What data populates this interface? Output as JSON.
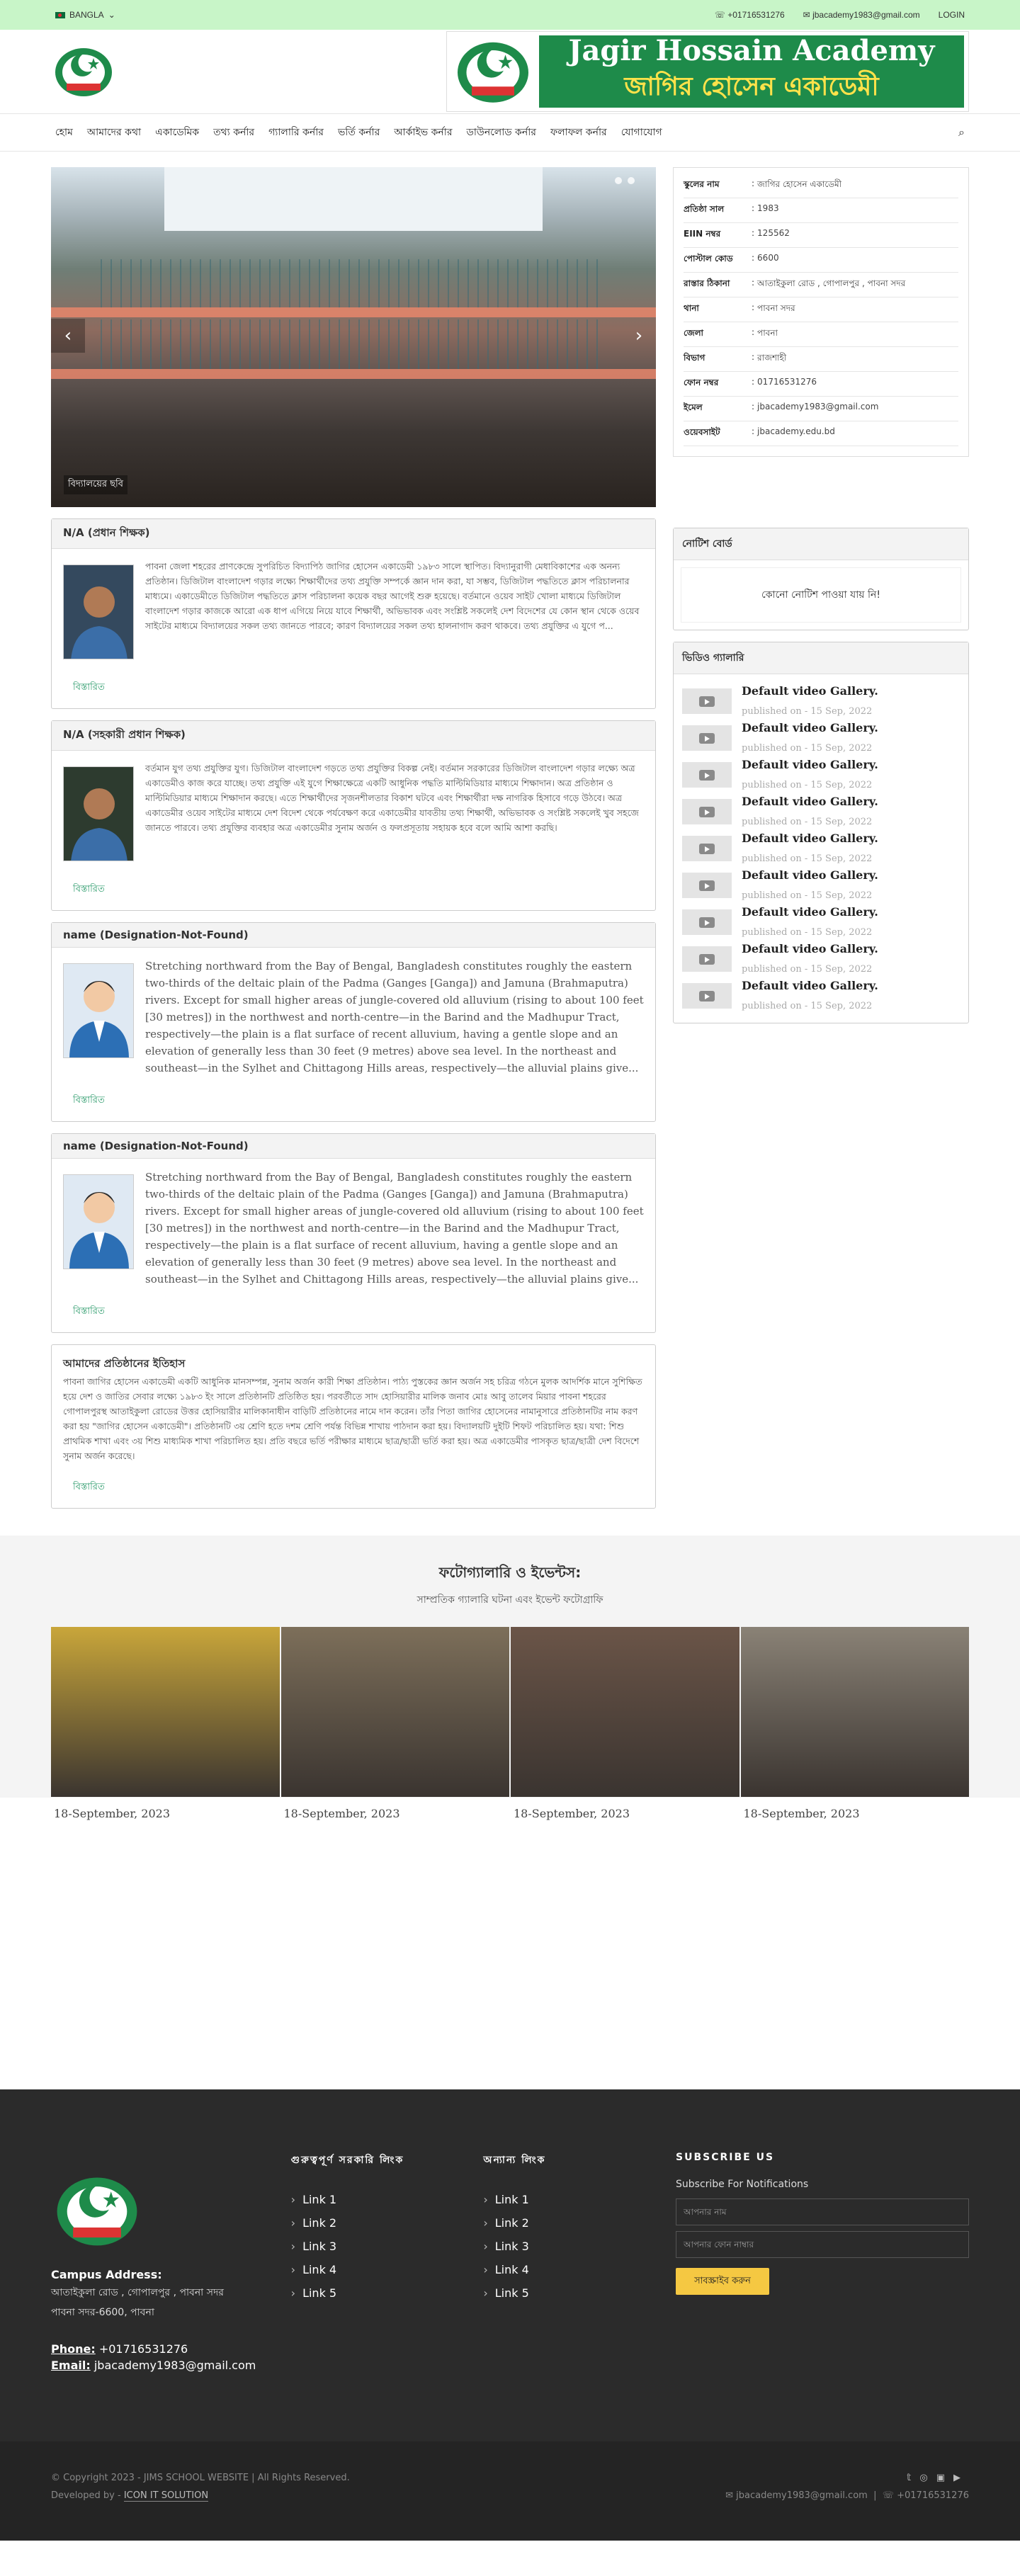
{
  "topbar": {
    "language": "BANGLA",
    "phone": "+01716531276",
    "email": "jbacademy1983@gmail.com",
    "login": "LOGIN"
  },
  "banner": {
    "title_en": "Jagir Hossain Academy",
    "title_bn": "জাগির হোসেন একাডেমী"
  },
  "nav": [
    "হোম",
    "আমাদের কথা",
    "একাডেমিক",
    "তথ্য কর্নার",
    "গ্যালারি কর্নার",
    "ভর্তি কর্নার",
    "আর্কাইভ কর্নার",
    "ডাউনলোড কর্নার",
    "ফলাফল কর্নার",
    "যোগাযোগ"
  ],
  "slider": {
    "caption": "বিদ্যালয়ের ছবি"
  },
  "info": [
    {
      "k": "স্কুলের নাম",
      "v": "জাগির হোসেন একাডেমী"
    },
    {
      "k": "প্রতিষ্ঠা সাল",
      "v": "1983"
    },
    {
      "k": "EIIN নম্বর",
      "v": "125562"
    },
    {
      "k": "পোস্টাল কোড",
      "v": "6600"
    },
    {
      "k": "রাস্তার ঠিকানা",
      "v": "আতাইকুলা রোড , গোপালপুর , পাবনা সদর"
    },
    {
      "k": "থানা",
      "v": "পাবনা সদর"
    },
    {
      "k": "জেলা",
      "v": "পাবনা"
    },
    {
      "k": "বিভাগ",
      "v": "রাজশাহী"
    },
    {
      "k": "ফোন নম্বর",
      "v": "01716531276"
    },
    {
      "k": "ইমেল",
      "v": "jbacademy1983@gmail.com"
    },
    {
      "k": "ওয়েবসাইট",
      "v": "jbacademy.edu.bd"
    }
  ],
  "cards": [
    {
      "title": "N/A (প্রধান শিক্ষক)",
      "body": "পাবনা জেলা শহরের প্রাণকেন্দ্রে সুপরিচিত বিদ্যাপিঠ জাগির হোসেন একাডেমী ১৯৮৩ সালে স্থাপিত। বিদ্যানুরাগী মেধাবিকাশের এক অনন্য প্রতিষ্ঠান। ডিজিটাল বাংলাদেশ গড়ার লক্ষ্যে শিক্ষার্থীদের তথ্য প্রযুক্তি সম্পর্কে জ্ঞান দান করা, যা সম্ভব, ডিজিটাল পদ্ধতিতে ক্লাস পরিচালনার মাধ্যমে। একাডেমীতে ডিজিটাল পদ্ধতিতে ক্লাস পরিচালনা কয়েক বছর আগেই শুরু হয়েছে। বর্তমানে ওয়েব সাইট খোলা মাধ্যমে ডিজিটাল বাংলাদেশ গড়ার কাজকে আরো এক ধাপ এগিয়ে নিয়ে যাবে শিক্ষার্থী, অভিভাবক এবং সংশ্লিষ্ট সকলেই দেশ বিদেশের যে কোন স্থান থেকে ওয়েব সাইটের মাধ্যমে বিদ্যালয়ের সকল তথ্য জানতে পারবে; কারণ বিদ্যালয়ের সকল তথ্য হালনাগাদ করণ থাকবে। তথ্য প্রযুক্তির এ যুগে প...",
      "read": "বিস্তারিত",
      "en": false,
      "photo": "person1"
    },
    {
      "title": "N/A (সহকারী প্রধান শিক্ষক)",
      "body": "বর্তমান যুগ তথ্য প্রযুক্তির যুগ। ডিজিটাল বাংলাদেশ গড়তে তথ্য প্রযুক্তির বিকল্প নেই। বর্তমান সরকারের ডিজিটাল বাংলাদেশ গড়ার লক্ষ্যে অত্র একাডেমীও কাজ করে যাচ্ছে। তথ্য প্রযুক্তি এই যুগে শিক্ষাক্ষেত্রে একটি আধুনিক পদ্ধতি মাল্টিমিডিয়ার মাধ্যমে শিক্ষাদান। অত্র প্রতিষ্ঠান ও মাল্টিমিডিয়ার মাধ্যমে শিক্ষাদান করছে। এতে শিক্ষার্থীদের সৃজনশীলতার বিকাশ ঘটবে এবং শিক্ষার্থীরা দক্ষ নাগরিক হিসাবে গড়ে উঠবে। অত্র একাডেমীর ওয়েব সাইটের মাধ্যমে দেশ বিদেশ থেকে পর্যবেক্ষণ করে একাডেমীর যাবতীয় তথ্য শিক্ষার্থী, অভিভাবক ও সংশ্লিষ্ট সকলেই খুব সহজে জানতে পারবে। তথ্য প্রযুক্তির ব্যবহার অত্র একাডেমীর সুনাম অর্জন ও ফলপ্রসূতায় সহায়ক হবে বলে আমি আশা করছি।",
      "read": "বিস্তারিত",
      "en": false,
      "photo": "person2"
    },
    {
      "title": "name (Designation-Not-Found)",
      "body": "Stretching northward from the Bay of Bengal, Bangladesh constitutes roughly the eastern two-thirds of the deltaic plain of the Padma (Ganges [Ganga]) and Jamuna (Brahmaputra) rivers. Except for small higher areas of jungle-covered old alluvium (rising to about 100 feet [30 metres]) in the northwest and north-centre—in the Barind and the Madhupur Tract, respectively—the plain is a flat surface of recent alluvium, having a gentle slope and an elevation of generally less than 30 feet (9 metres) above sea level. In the northeast and southeast—in the Sylhet and Chittagong Hills areas, respectively—the alluvial plains give...",
      "read": "বিস্তারিত",
      "en": true,
      "photo": "avatar"
    },
    {
      "title": "name (Designation-Not-Found)",
      "body": "Stretching northward from the Bay of Bengal, Bangladesh constitutes roughly the eastern two-thirds of the deltaic plain of the Padma (Ganges [Ganga]) and Jamuna (Brahmaputra) rivers. Except for small higher areas of jungle-covered old alluvium (rising to about 100 feet [30 metres]) in the northwest and north-centre—in the Barind and the Madhupur Tract, respectively—the plain is a flat surface of recent alluvium, having a gentle slope and an elevation of generally less than 30 feet (9 metres) above sea level. In the northeast and southeast—in the Sylhet and Chittagong Hills areas, respectively—the alluvial plains give...",
      "read": "বিস্তারিত",
      "en": true,
      "photo": "avatar"
    }
  ],
  "history": {
    "title": "আমাদের প্রতিষ্ঠানের ইতিহাস",
    "body": "পাবনা জাগির হোসেন একাডেমী একটি আধুনিক মানসম্পন্ন, সুনাম অর্জন কারী শিক্ষা প্রতিষ্ঠান। পাঠ্য পুস্তকের জ্ঞান অর্জন সহ চরিত্র গঠনে মুলক আদর্শিক মানে সুশিক্ষিত হয়ে দেশ ও জাতির সেবার লক্ষ্যে ১৯৮৩ ইং সালে প্রতিষ্ঠানটি প্রতিষ্ঠিত হয়। পরবর্তীতে সাদ হোসিয়ারীর মালিক জনাব মোঃ আবু তালেব মিয়ার পাবনা শহরের গোপালপুরস্থ আতাইকুলা রোডের উত্তর হোসিয়ারীর মালিকানাধীন বাড়িটি প্রতিষ্ঠানের নামে দান করেন। তাঁর পিতা জাগির হোসেনের নামানুসারে প্রতিষ্ঠানটির নাম করণ করা হয় \"জাগির হোসেন একাডেমী\"। প্রতিষ্ঠানটি ৩য় শ্রেণি হতে দশম শ্রেণি পর্যন্ত বিভিন্ন শাখায় পাঠদান করা হয়। বিদ্যালয়টি দুইটি শিফট পরিচালিত হয়। যথা: শিশু প্রাথমিক শাখা এবং ৩য় শিশু মাধ্যমিক শাখা পরিচালিত হয়। প্রতি বছরে ভর্তি পরীক্ষার মাধ্যমে ছাত্র/ছাত্রী ভর্তি করা হয়। অত্র একাডেমীর পাসকৃত ছাত্র/ছাত্রী দেশ বিদেশে সুনাম অর্জন করেছে।",
    "read": "বিস্তারিত"
  },
  "notice": {
    "title": "নোটিশ বোর্ড",
    "empty": "কোনো নোটিশ পাওয়া যায় নি!"
  },
  "videos": {
    "title": "ভিডিও গ্যালারি",
    "items": [
      {
        "title": "Default video Gallery.",
        "date": "published on - 15 Sep, 2022"
      },
      {
        "title": "Default video Gallery.",
        "date": "published on - 15 Sep, 2022"
      },
      {
        "title": "Default video Gallery.",
        "date": "published on - 15 Sep, 2022"
      },
      {
        "title": "Default video Gallery.",
        "date": "published on - 15 Sep, 2022"
      },
      {
        "title": "Default video Gallery.",
        "date": "published on - 15 Sep, 2022"
      },
      {
        "title": "Default video Gallery.",
        "date": "published on - 15 Sep, 2022"
      },
      {
        "title": "Default video Gallery.",
        "date": "published on - 15 Sep, 2022"
      },
      {
        "title": "Default video Gallery.",
        "date": "published on - 15 Sep, 2022"
      },
      {
        "title": "Default video Gallery.",
        "date": "published on - 15 Sep, 2022"
      }
    ]
  },
  "gallery": {
    "title": "ফটোগ্যালারি ও ইভেন্টস:",
    "subtitle": "সাম্প্রতিক গ্যালারি ঘটনা এবং ইভেন্ট ফটোগ্রাফি",
    "items": [
      {
        "date": "18-September, 2023",
        "color": "#c9a63a"
      },
      {
        "date": "18-September, 2023",
        "color": "#7d6f5a"
      },
      {
        "date": "18-September, 2023",
        "color": "#6b5548"
      },
      {
        "date": "18-September, 2023",
        "color": "#8a8276"
      }
    ]
  },
  "footer": {
    "address_label": "Campus Address:",
    "address1": "আতাইকুলা রোড , গোপালপুর , পাবনা সদর",
    "address2": "পাবনা সদর-6600, পাবনা",
    "phone_label": "Phone:",
    "phone": "+01716531276",
    "email_label": "Email:",
    "email": "jbacademy1983@gmail.com",
    "col2_title": "গুরুত্বপূর্ণ সরকারি লিংক",
    "col3_title": "অন্যান্য লিংক",
    "links": [
      "Link 1",
      "Link 2",
      "Link 3",
      "Link 4",
      "Link 5"
    ],
    "subscribe_title": "SUBSCRIBE US",
    "subscribe_sub": "Subscribe For Notifications",
    "name_ph": "আপনার নাম",
    "phone_ph": "আপনার ফোন নাম্বার",
    "btn": "সাবস্ক্রাইব করুন"
  },
  "copyright": {
    "text": "© Copyright 2023 - JIMS SCHOOL WEBSITE | All Rights Reserved.",
    "dev_label": "Developed by -",
    "dev": "ICON IT SOLUTION",
    "email": "jbacademy1983@gmail.com",
    "phone": "+01716531276"
  }
}
